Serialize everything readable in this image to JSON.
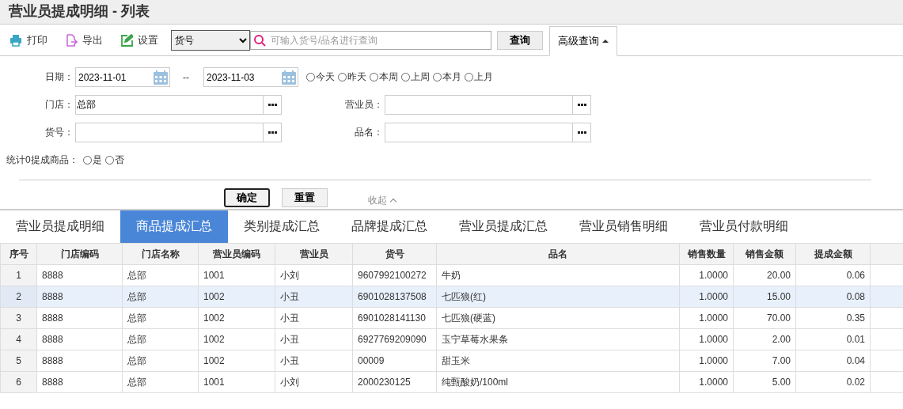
{
  "title": "营业员提成明细 - 列表",
  "toolbar": {
    "buttons": [
      {
        "label": "打印",
        "kind": "print"
      },
      {
        "label": "导出",
        "kind": "export"
      },
      {
        "label": "设置",
        "kind": "settings"
      }
    ],
    "search_type": "货号",
    "search": {
      "placeholder": "可输入货号/品名进行查询"
    },
    "query_button": "查询",
    "advanced_query": {
      "label": "高级查询",
      "expanded": true
    }
  },
  "filters": {
    "date": {
      "label": "日期：",
      "from": "2023-11-01",
      "separator": "--",
      "to": "2023-11-03"
    },
    "date_presets": [
      {
        "label": "今天",
        "selected": false
      },
      {
        "label": "昨天",
        "selected": false
      },
      {
        "label": "本周",
        "selected": false
      },
      {
        "label": "上周",
        "selected": false
      },
      {
        "label": "本月",
        "selected": false
      },
      {
        "label": "上月",
        "selected": false
      }
    ],
    "fields": [
      {
        "label": "门店：",
        "value": "总部"
      },
      {
        "label": "营业员："
      },
      {
        "label": "货号："
      },
      {
        "label": "品名："
      }
    ],
    "zero_commission": {
      "label": "统计0提成商品：",
      "options": [
        {
          "label": "是",
          "selected": false
        },
        {
          "label": "否",
          "selected": false
        }
      ]
    },
    "confirm_button": "确定",
    "reset_button": "重置",
    "collapse": "收起"
  },
  "tabs": [
    {
      "label": "营业员提成明细",
      "selected": false
    },
    {
      "label": "商品提成汇总",
      "selected": true
    },
    {
      "label": "类别提成汇总",
      "selected": false
    },
    {
      "label": "品牌提成汇总",
      "selected": false
    },
    {
      "label": "营业员提成汇总",
      "selected": false
    },
    {
      "label": "营业员销售明细",
      "selected": false
    },
    {
      "label": "营业员付款明细",
      "selected": false
    }
  ],
  "table": {
    "columns": [
      "序号",
      "门店编码",
      "门店名称",
      "营业员编码",
      "营业员",
      "货号",
      "品名",
      "销售数量",
      "销售金额",
      "提成金额"
    ],
    "rows": [
      {
        "cells": [
          "1",
          "8888",
          "总部",
          "1001",
          "小刘",
          "9607992100272",
          "牛奶",
          "1.0000",
          "20.00",
          "0.06"
        ],
        "selected": false
      },
      {
        "cells": [
          "2",
          "8888",
          "总部",
          "1002",
          "小丑",
          "6901028137508",
          "七匹狼(红)",
          "1.0000",
          "15.00",
          "0.08"
        ],
        "selected": true
      },
      {
        "cells": [
          "3",
          "8888",
          "总部",
          "1002",
          "小丑",
          "6901028141130",
          "七匹狼(硬蓝)",
          "1.0000",
          "70.00",
          "0.35"
        ],
        "selected": false
      },
      {
        "cells": [
          "4",
          "8888",
          "总部",
          "1002",
          "小丑",
          "6927769209090",
          "玉宁草莓水果条",
          "1.0000",
          "2.00",
          "0.01"
        ],
        "selected": false
      },
      {
        "cells": [
          "5",
          "8888",
          "总部",
          "1002",
          "小丑",
          "00009",
          "甜玉米",
          "1.0000",
          "7.00",
          "0.04"
        ],
        "selected": false
      },
      {
        "cells": [
          "6",
          "8888",
          "总部",
          "1001",
          "小刘",
          "2000230125",
          "纯甄酸奶/100ml",
          "1.0000",
          "5.00",
          "0.02"
        ],
        "selected": false
      }
    ]
  }
}
